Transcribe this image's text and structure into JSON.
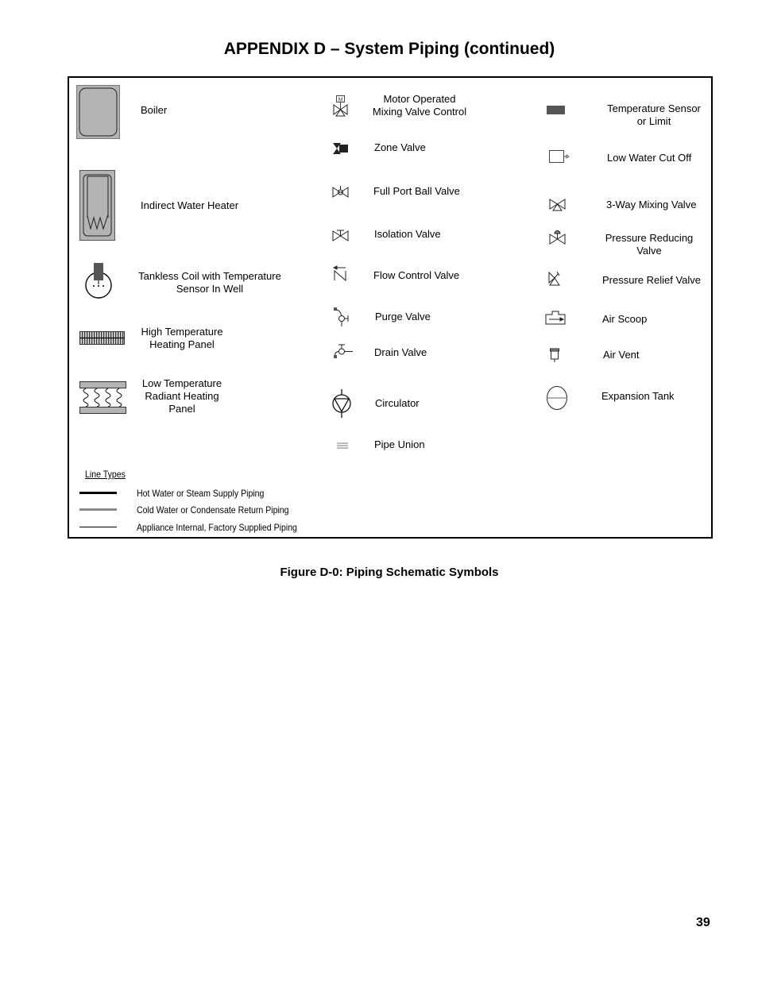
{
  "page": {
    "title": "APPENDIX D – System Piping (continued)",
    "caption": "Figure D-0:  Piping Schematic Symbols",
    "page_number": "39"
  },
  "symbols": {
    "col1": [
      {
        "icon": "boiler-icon",
        "label_lines": [
          "Boiler"
        ]
      },
      {
        "icon": "indirect-water-heater-icon",
        "label_lines": [
          "Indirect Water Heater"
        ]
      },
      {
        "icon": "tankless-coil-icon",
        "label_lines": [
          "Tankless Coil with Temperature",
          "Sensor In Well"
        ]
      },
      {
        "icon": "high-temperature-panel-icon",
        "label_lines": [
          "High Temperature",
          "Heating Panel"
        ]
      },
      {
        "icon": "low-temperature-radiant-panel-icon",
        "label_lines": [
          "Low Temperature",
          "Radiant Heating",
          "Panel"
        ]
      }
    ],
    "col2": [
      {
        "icon": "motor-operated-mixing-valve-icon",
        "label_lines": [
          "Motor Operated",
          "Mixing Valve Control"
        ]
      },
      {
        "icon": "zone-valve-icon",
        "label_lines": [
          "Zone Valve"
        ]
      },
      {
        "icon": "full-port-ball-valve-icon",
        "label_lines": [
          "Full Port Ball Valve"
        ]
      },
      {
        "icon": "isolation-valve-icon",
        "label_lines": [
          "Isolation Valve"
        ]
      },
      {
        "icon": "flow-control-valve-icon",
        "label_lines": [
          "Flow Control Valve"
        ]
      },
      {
        "icon": "purge-valve-icon",
        "label_lines": [
          "Purge Valve"
        ]
      },
      {
        "icon": "drain-valve-icon",
        "label_lines": [
          "Drain Valve"
        ]
      },
      {
        "icon": "circulator-icon",
        "label_lines": [
          "Circulator"
        ]
      },
      {
        "icon": "pipe-union-icon",
        "label_lines": [
          "Pipe Union"
        ]
      }
    ],
    "col3": [
      {
        "icon": "temperature-sensor-icon",
        "label_lines": [
          "Temperature Sensor",
          "or Limit"
        ]
      },
      {
        "icon": "low-water-cut-off-icon",
        "label_lines": [
          "Low Water Cut Off"
        ]
      },
      {
        "icon": "three-way-mixing-valve-icon",
        "label_lines": [
          "3-Way Mixing Valve"
        ]
      },
      {
        "icon": "pressure-reducing-valve-icon",
        "label_lines": [
          "Pressure Reducing",
          "Valve"
        ]
      },
      {
        "icon": "pressure-relief-valve-icon",
        "label_lines": [
          "Pressure Relief Valve"
        ]
      },
      {
        "icon": "air-scoop-icon",
        "label_lines": [
          "Air Scoop"
        ]
      },
      {
        "icon": "air-vent-icon",
        "label_lines": [
          "Air Vent"
        ]
      },
      {
        "icon": "expansion-tank-icon",
        "label_lines": [
          "Expansion Tank"
        ]
      }
    ]
  },
  "line_types": {
    "heading": "Line Types",
    "items": [
      {
        "label": "Hot Water or Steam Supply Piping",
        "color": "#000000"
      },
      {
        "label": "Cold Water or Condensate Return Piping",
        "color": "#8a8a8a"
      },
      {
        "label": "Appliance Internal, Factory Supplied Piping",
        "color": "#000000"
      }
    ]
  }
}
